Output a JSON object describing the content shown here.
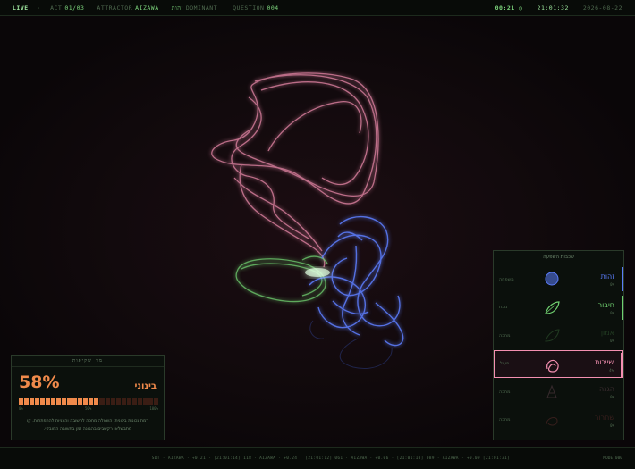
{
  "topbar": {
    "live": "LIVE",
    "sep": "·",
    "act_label": "ACT",
    "act_value": "01/03",
    "attractor_label": "ATTRACTOR",
    "attractor_value": "AIZAWA",
    "dominant_value": "זהות",
    "dominant_label": "DOMINANT",
    "question_label": "QUESTION",
    "question_value": "004",
    "timer": "00:21 ◷",
    "clock": "21:01:32",
    "date": "2026-08-22"
  },
  "confidence": {
    "title": "מד שקיפות",
    "percent": "58%",
    "percent_value": 58,
    "level": "בינוני",
    "scale_low": "0%",
    "scale_mid": "50%",
    "scale_high": "100%",
    "description_line1": "רמת נכונות בינונית. השאלה מחכה לתשובה והרגיות להתפתחות. קו",
    "description_line2": "מתבשלאו רקשבים בהבונה זמן בתשובה המובקי.",
    "accent_color": "#f08a4b"
  },
  "layers": {
    "title": "שכבות השפעה",
    "items": [
      {
        "name": "זהות",
        "sub": "0%",
        "state": "משפחה",
        "color": "#5b7cfa",
        "icon": "blue-sphere-icon",
        "dim": false
      },
      {
        "name": "חיבור",
        "sub": "0%",
        "state": "נוכח",
        "color": "#6fcf6f",
        "icon": "green-leaf-icon",
        "dim": false
      },
      {
        "name": "אמון",
        "sub": "0%",
        "state": "מחכה",
        "color": "#4a8a4a",
        "icon": "faded-leaf-icon",
        "dim": true
      },
      {
        "name": "שייכות",
        "sub": "4%",
        "state": "פעיל",
        "color": "#f48fb1",
        "icon": "pink-loop-icon",
        "dim": false
      },
      {
        "name": "הגנה",
        "sub": "0%",
        "state": "מחכה",
        "color": "#8a5a6a",
        "icon": "faded-shape-icon",
        "dim": true
      },
      {
        "name": "שחרור",
        "sub": "0%",
        "state": "מחכה",
        "color": "#8a3a3a",
        "icon": "faded-red-icon",
        "dim": true
      }
    ]
  },
  "footer": {
    "log": "SDT · AIZAWA · +0.21 · [21:01:14] 118 · AIZAWA · +0.24 · [21:01:12] 061 · AIZAWA · +0.06 · [21:01:10] 089 · AIZAWA · +0.09 [21:01:31]",
    "mode": "MODE 000"
  },
  "colors": {
    "pink_trail": "#f48fb1",
    "blue_trail": "#5b7cfa",
    "green_trail": "#6fcf6f"
  }
}
